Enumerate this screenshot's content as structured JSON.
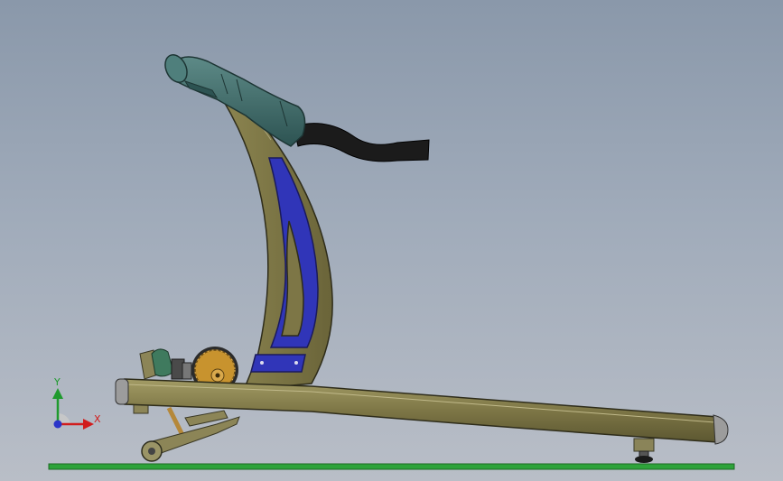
{
  "viewport": {
    "kind": "3d-cad-viewport",
    "background_top": "#8a98aa",
    "background_bottom": "#b9bec7"
  },
  "model": {
    "name": "treadmill",
    "parts": [
      "handlebar-grip",
      "handlebar-cable",
      "upright-frame",
      "frame-window-panel",
      "rail-deck",
      "motor-pulley",
      "flywheel",
      "incline-linkage",
      "caster-wheel",
      "leveling-foot",
      "ground-plane"
    ],
    "colors": {
      "frame": "#7d7646",
      "frame_dark": "#55512c",
      "panel": "#3035b8",
      "grip": "#3f6b6b",
      "cable": "#1b1b1b",
      "pulley": "#c8932e",
      "ground": "#2ea33a",
      "end_cap": "#9c9c9c"
    }
  },
  "triad": {
    "y_label": "Y",
    "x_label": "X",
    "y_color": "#1f9a2e",
    "x_color": "#d11c1c",
    "z_color": "#2b35c9"
  }
}
